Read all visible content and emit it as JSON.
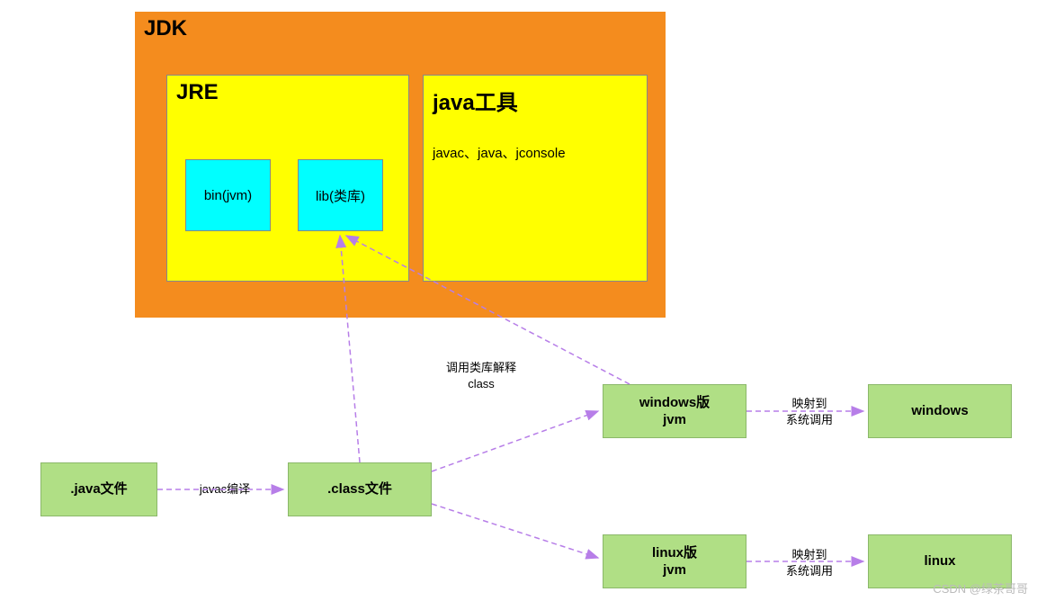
{
  "jdk": {
    "label": "JDK",
    "jre": {
      "label": "JRE",
      "bin": "bin(jvm)",
      "lib": "lib(类库)"
    },
    "tools": {
      "label": "java工具",
      "desc": "javac、java、jconsole"
    }
  },
  "nodes": {
    "javaFile": ".java文件",
    "classFile": ".class文件",
    "winJvm": "windows版\njvm",
    "linuxJvm": "linux版\njvm",
    "windows": "windows",
    "linux": "linux"
  },
  "edges": {
    "javac": "javac编译",
    "libCall": "调用类库解释\nclass",
    "mapWin": "映射到\n系统调用",
    "mapLinux": "映射到\n系统调用"
  },
  "watermark": "CSDN @绿茶哥哥"
}
